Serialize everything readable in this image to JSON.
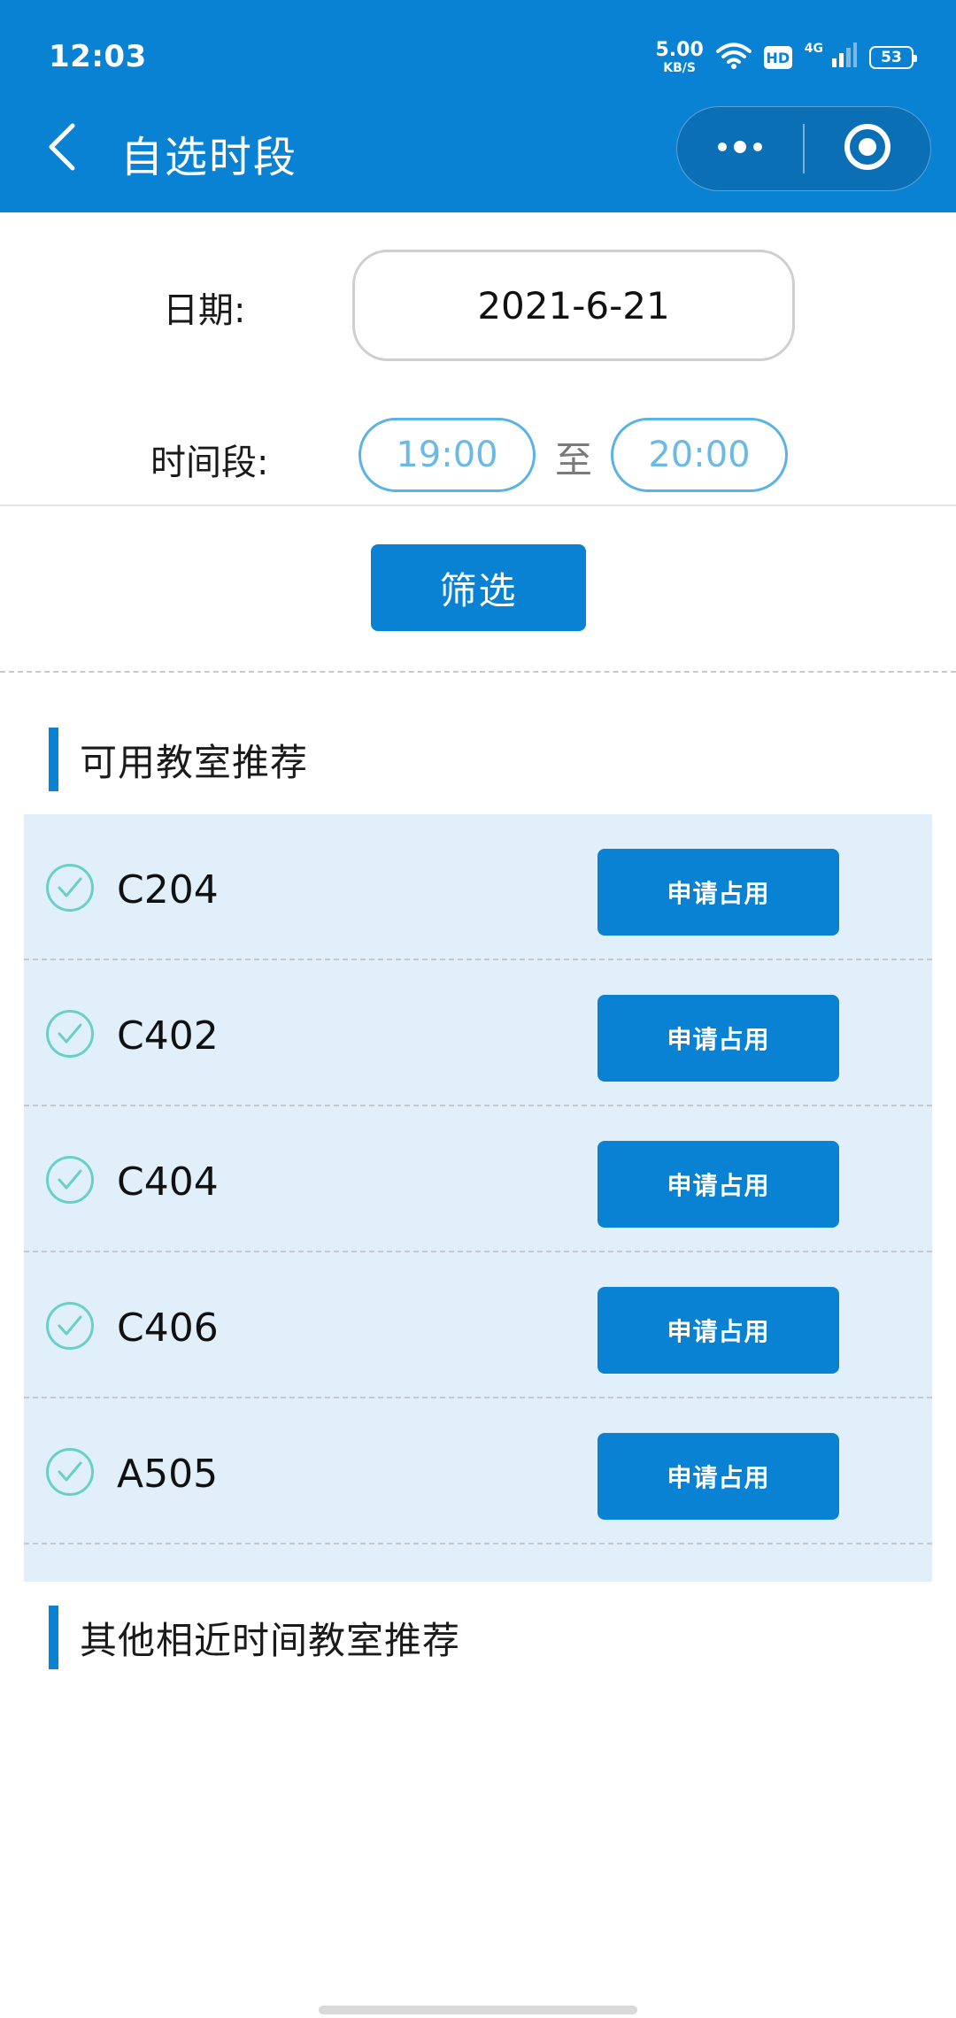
{
  "status_bar": {
    "time": "12:03",
    "net_speed": "5.00",
    "net_speed_unit": "KB/S",
    "hd": "HD",
    "network": "4G",
    "battery": "53"
  },
  "nav": {
    "title": "自选时段",
    "back_icon": "chevron-left-icon",
    "more_icon": "more-dots-icon",
    "close_icon": "target-close-icon"
  },
  "filters": {
    "date_label": "日期:",
    "date_value": "2021-6-21",
    "time_label": "时间段:",
    "time_start": "19:00",
    "time_separator": "至",
    "time_end": "20:00",
    "filter_button": "筛选"
  },
  "available": {
    "title": "可用教室推荐",
    "rooms": [
      {
        "name": "C204",
        "action": "申请占用"
      },
      {
        "name": "C402",
        "action": "申请占用"
      },
      {
        "name": "C404",
        "action": "申请占用"
      },
      {
        "name": "C406",
        "action": "申请占用"
      },
      {
        "name": "A505",
        "action": "申请占用"
      }
    ]
  },
  "other": {
    "title": "其他相近时间教室推荐"
  },
  "colors": {
    "primary": "#0a82d4",
    "list_bg": "#e1effb",
    "check": "#69d0c6",
    "time_text": "#6db9e6"
  }
}
